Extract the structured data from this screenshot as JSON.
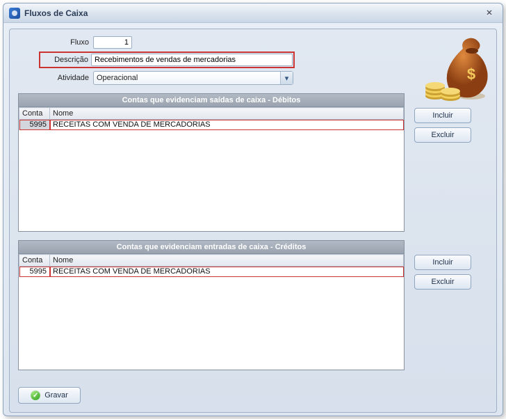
{
  "window": {
    "title": "Fluxos de Caixa"
  },
  "form": {
    "fluxo_label": "Fluxo",
    "fluxo_value": "1",
    "descricao_label": "Descrição",
    "descricao_value": "Recebimentos de vendas de mercadorias",
    "atividade_label": "Atividade",
    "atividade_value": "Operacional"
  },
  "sections": {
    "debitos": {
      "title": "Contas que evidenciam saídas de caixa - Débitos",
      "col_conta": "Conta",
      "col_nome": "Nome",
      "rows": [
        {
          "conta": "5995",
          "nome": "RECEITAS COM VENDA DE MERCADORIAS"
        }
      ]
    },
    "creditos": {
      "title": "Contas que evidenciam entradas de caixa - Créditos",
      "col_conta": "Conta",
      "col_nome": "Nome",
      "rows": [
        {
          "conta": "5995",
          "nome": "RECEITAS COM VENDA DE MERCADORIAS"
        }
      ]
    }
  },
  "buttons": {
    "incluir": "Incluir",
    "excluir": "Excluir",
    "gravar": "Gravar"
  }
}
